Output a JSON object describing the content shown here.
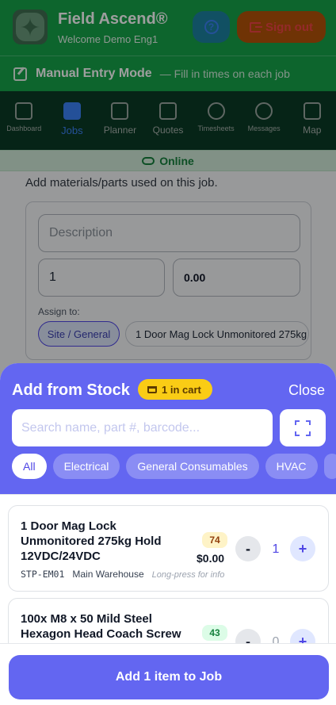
{
  "header": {
    "app_title": "Field Ascend®",
    "welcome": "Welcome Demo Eng1",
    "help_label": "?",
    "signout_label": "Sign out"
  },
  "manual_mode": {
    "title": "Manual Entry Mode",
    "subtitle": "— Fill in times on each job"
  },
  "nav": {
    "items": [
      {
        "label": "Dashboard",
        "icon": "grid-icon"
      },
      {
        "label": "Jobs",
        "icon": "briefcase-icon",
        "active": true
      },
      {
        "label": "Planner",
        "icon": "calendar-icon"
      },
      {
        "label": "Quotes",
        "icon": "document-icon"
      },
      {
        "label": "Timesheets",
        "icon": "clock-icon"
      },
      {
        "label": "Messages",
        "icon": "chat-icon"
      },
      {
        "label": "Map",
        "icon": "map-icon"
      }
    ]
  },
  "status": {
    "online_label": "Online"
  },
  "materials": {
    "subtitle": "Add materials/parts used on this job.",
    "description_placeholder": "Description",
    "quantity": "1",
    "price": "0.00",
    "assign_label": "Assign to:",
    "assign_options": [
      "Site / General",
      "1 Door Mag Lock Unmonitored 275kg"
    ]
  },
  "sheet": {
    "title": "Add from Stock",
    "cart_badge": "1 in cart",
    "close_label": "Close",
    "search_placeholder": "Search name, part #, barcode...",
    "categories": [
      "All",
      "Electrical",
      "General Consumables",
      "HVAC"
    ],
    "active_category": "All",
    "items": [
      {
        "name": "1 Door Mag Lock Unmonitored 275kg Hold 12VDC/24VDC",
        "sku": "STP-EM01",
        "location": "Main Warehouse",
        "hint": "Long-press for info",
        "stock": "74",
        "price": "$0.00",
        "qty": "1"
      },
      {
        "name": "100x  M8 x 50 Mild Steel Hexagon Head Coach Screw",
        "stock": "43",
        "qty": "0"
      }
    ],
    "minus_label": "-",
    "plus_label": "+",
    "add_button": "Add 1 item to Job"
  }
}
